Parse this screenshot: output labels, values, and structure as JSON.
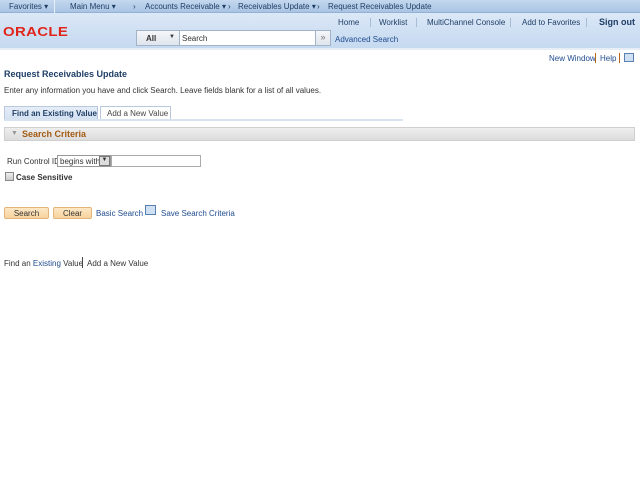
{
  "nav": {
    "favorites": "Favorites",
    "main_menu": "Main Menu",
    "crumbs": [
      "Accounts Receivable",
      "Receivables Update",
      "Request Receivables Update"
    ]
  },
  "header": {
    "links": [
      "Home",
      "Worklist",
      "MultiChannel Console",
      "Add to Favorites"
    ],
    "signout": "Sign out",
    "logo": "ORACLE",
    "search_scope": "All",
    "search_placeholder": "Search",
    "advanced": "Advanced Search"
  },
  "util": {
    "new_window": "New Window",
    "help": "Help"
  },
  "page": {
    "title": "Request Receivables Update",
    "instructions": "Enter any information you have and click Search. Leave fields blank for a list of all values.",
    "tabs": [
      "Find an Existing Value",
      "Add a New Value"
    ],
    "section": "Search Criteria",
    "field_label": "Run Control ID",
    "operator": "begins with",
    "field_value": "",
    "case_label": "Case Sensitive",
    "search_btn": "Search",
    "clear_btn": "Clear",
    "basic_search": "Basic Search",
    "save_criteria": "Save Search Criteria",
    "footer": {
      "find_prefix": "Find an ",
      "find_existing": "Existing",
      "find_suffix": " Value",
      "add": "Add a New Value"
    }
  },
  "colors": {
    "title": "#1f3e66",
    "section": "#a35a12",
    "link": "#1f4b8e"
  }
}
